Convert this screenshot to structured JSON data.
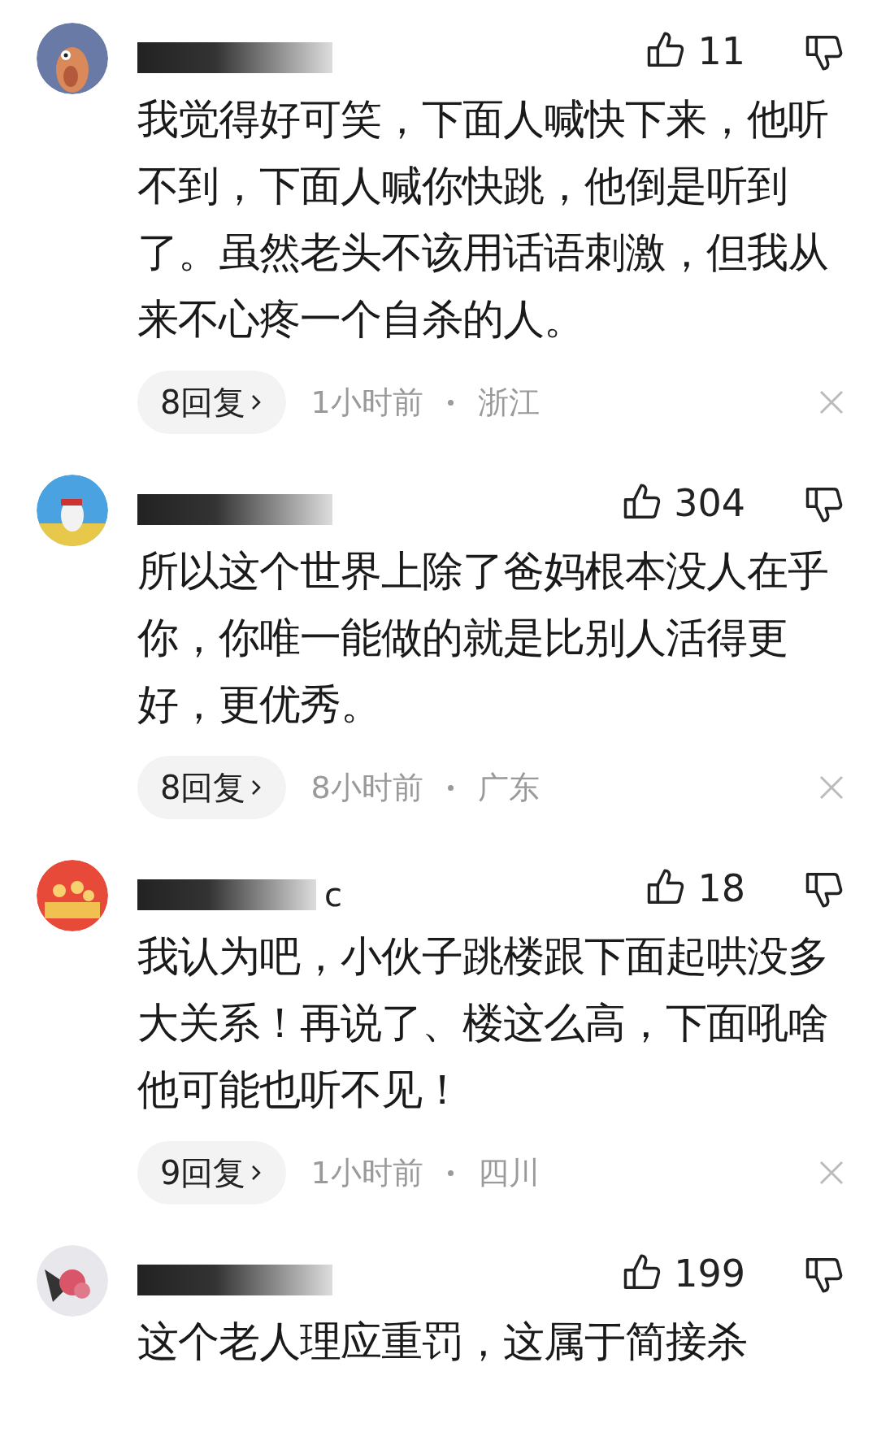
{
  "comments": [
    {
      "likes": "11",
      "text": "我觉得好可笑，下面人喊快下来，他听不到，下面人喊你快跳，他倒是听到了。虽然老头不该用话语刺激，但我从来不心疼一个自杀的人。",
      "replies": "8回复",
      "time": "1小时前",
      "region": "浙江"
    },
    {
      "likes": "304",
      "text": "所以这个世界上除了爸妈根本没人在乎你，你唯一能做的就是比别人活得更好，更优秀。",
      "replies": "8回复",
      "time": "8小时前",
      "region": "广东"
    },
    {
      "username_fragment": "c",
      "likes": "18",
      "text": "我认为吧，小伙子跳楼跟下面起哄没多大关系！再说了、楼这么高，下面吼啥他可能也听不见！",
      "replies": "9回复",
      "time": "1小时前",
      "region": "四川"
    },
    {
      "likes": "199",
      "text": "这个老人理应重罚，这属于简接杀"
    }
  ]
}
